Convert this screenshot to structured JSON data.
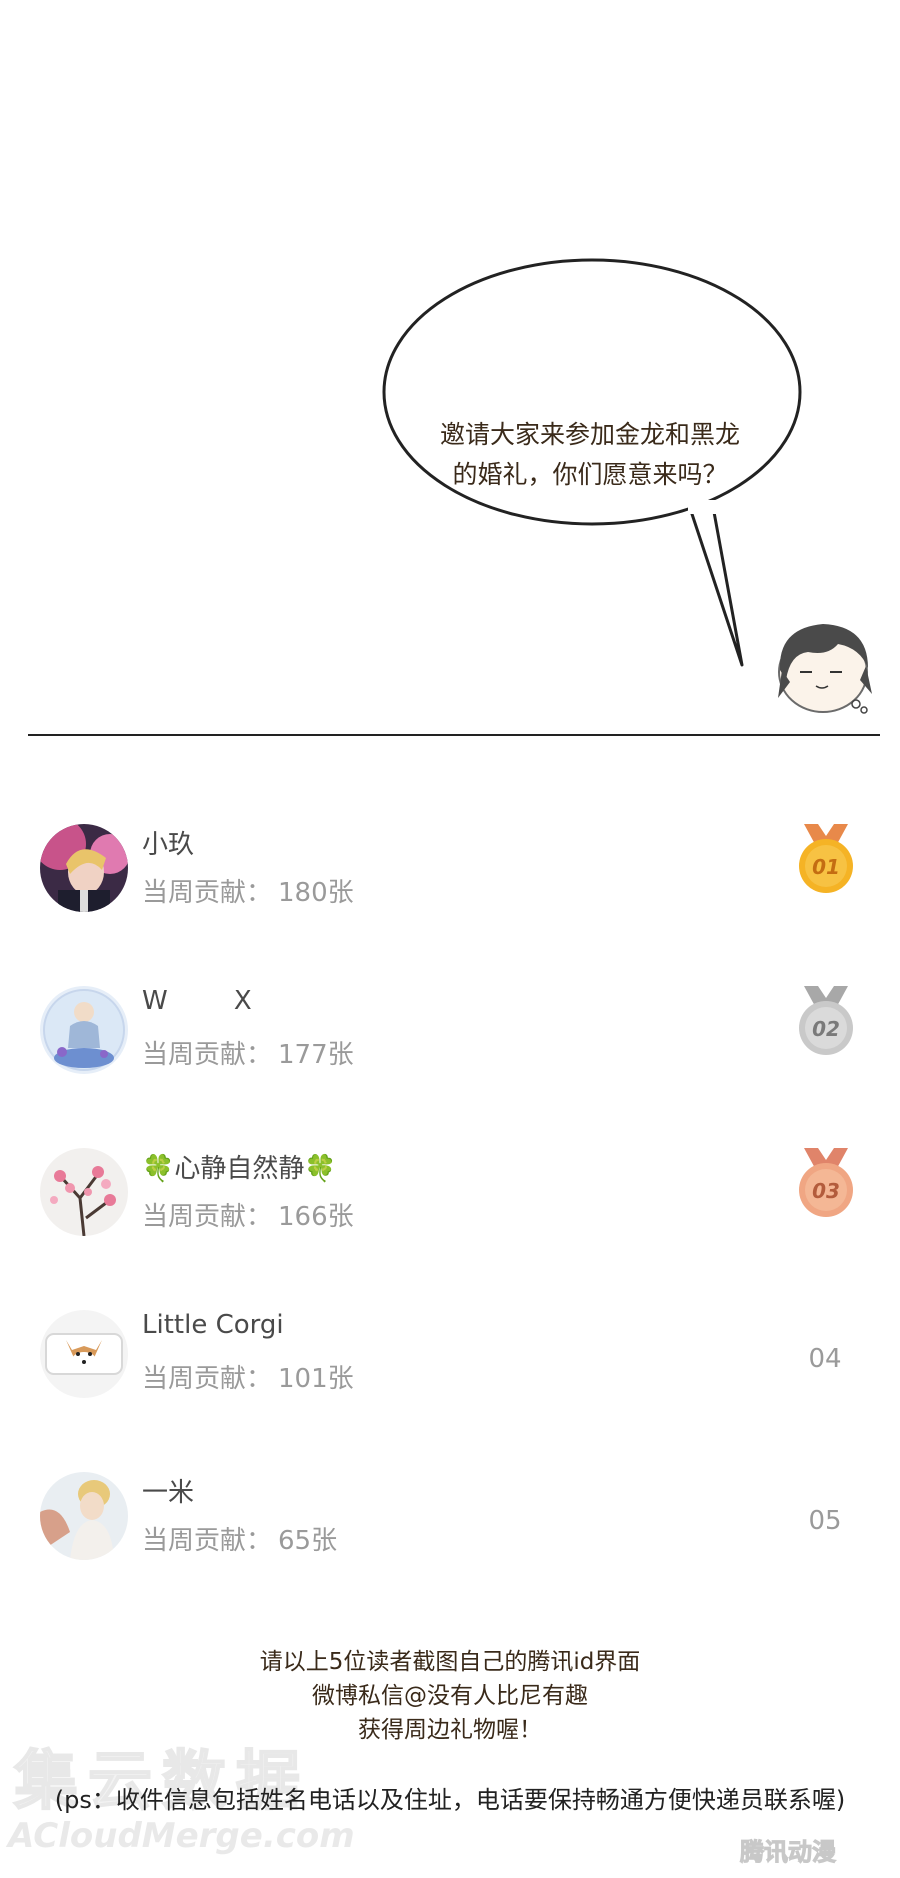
{
  "speech_bubble": {
    "line1": "邀请大家来参加金龙和黑龙",
    "line2": "的婚礼，你们愿意来吗？"
  },
  "ranking": {
    "contrib_label": "当周贡献：",
    "rows": [
      {
        "name": "小玖",
        "count": "180张",
        "rank": "01",
        "medal": "gold"
      },
      {
        "name": "W        X",
        "count": "177张",
        "rank": "02",
        "medal": "silver"
      },
      {
        "name": "🍀心静自然静🍀",
        "count": "166张",
        "rank": "03",
        "medal": "bronze"
      },
      {
        "name": "Little Corgi",
        "count": "101张",
        "rank": "04",
        "medal": ""
      },
      {
        "name": "一米",
        "count": "65张",
        "rank": "05",
        "medal": ""
      }
    ]
  },
  "footer": {
    "line1": "请以上5位读者截图自己的腾讯id界面",
    "line2": "微博私信@没有人比尼有趣",
    "line3": "获得周边礼物喔！",
    "ps": "(ps：收件信息包括姓名电话以及住址，电话要保持畅通方便快递员联系喔)"
  },
  "watermarks": {
    "left_big": "集云数据",
    "left_small": "ACloudMerge.com",
    "right": "腾讯动漫"
  },
  "colors": {
    "gold": "#f5b325",
    "silver": "#c9c9c9",
    "bronze": "#f0a683"
  }
}
